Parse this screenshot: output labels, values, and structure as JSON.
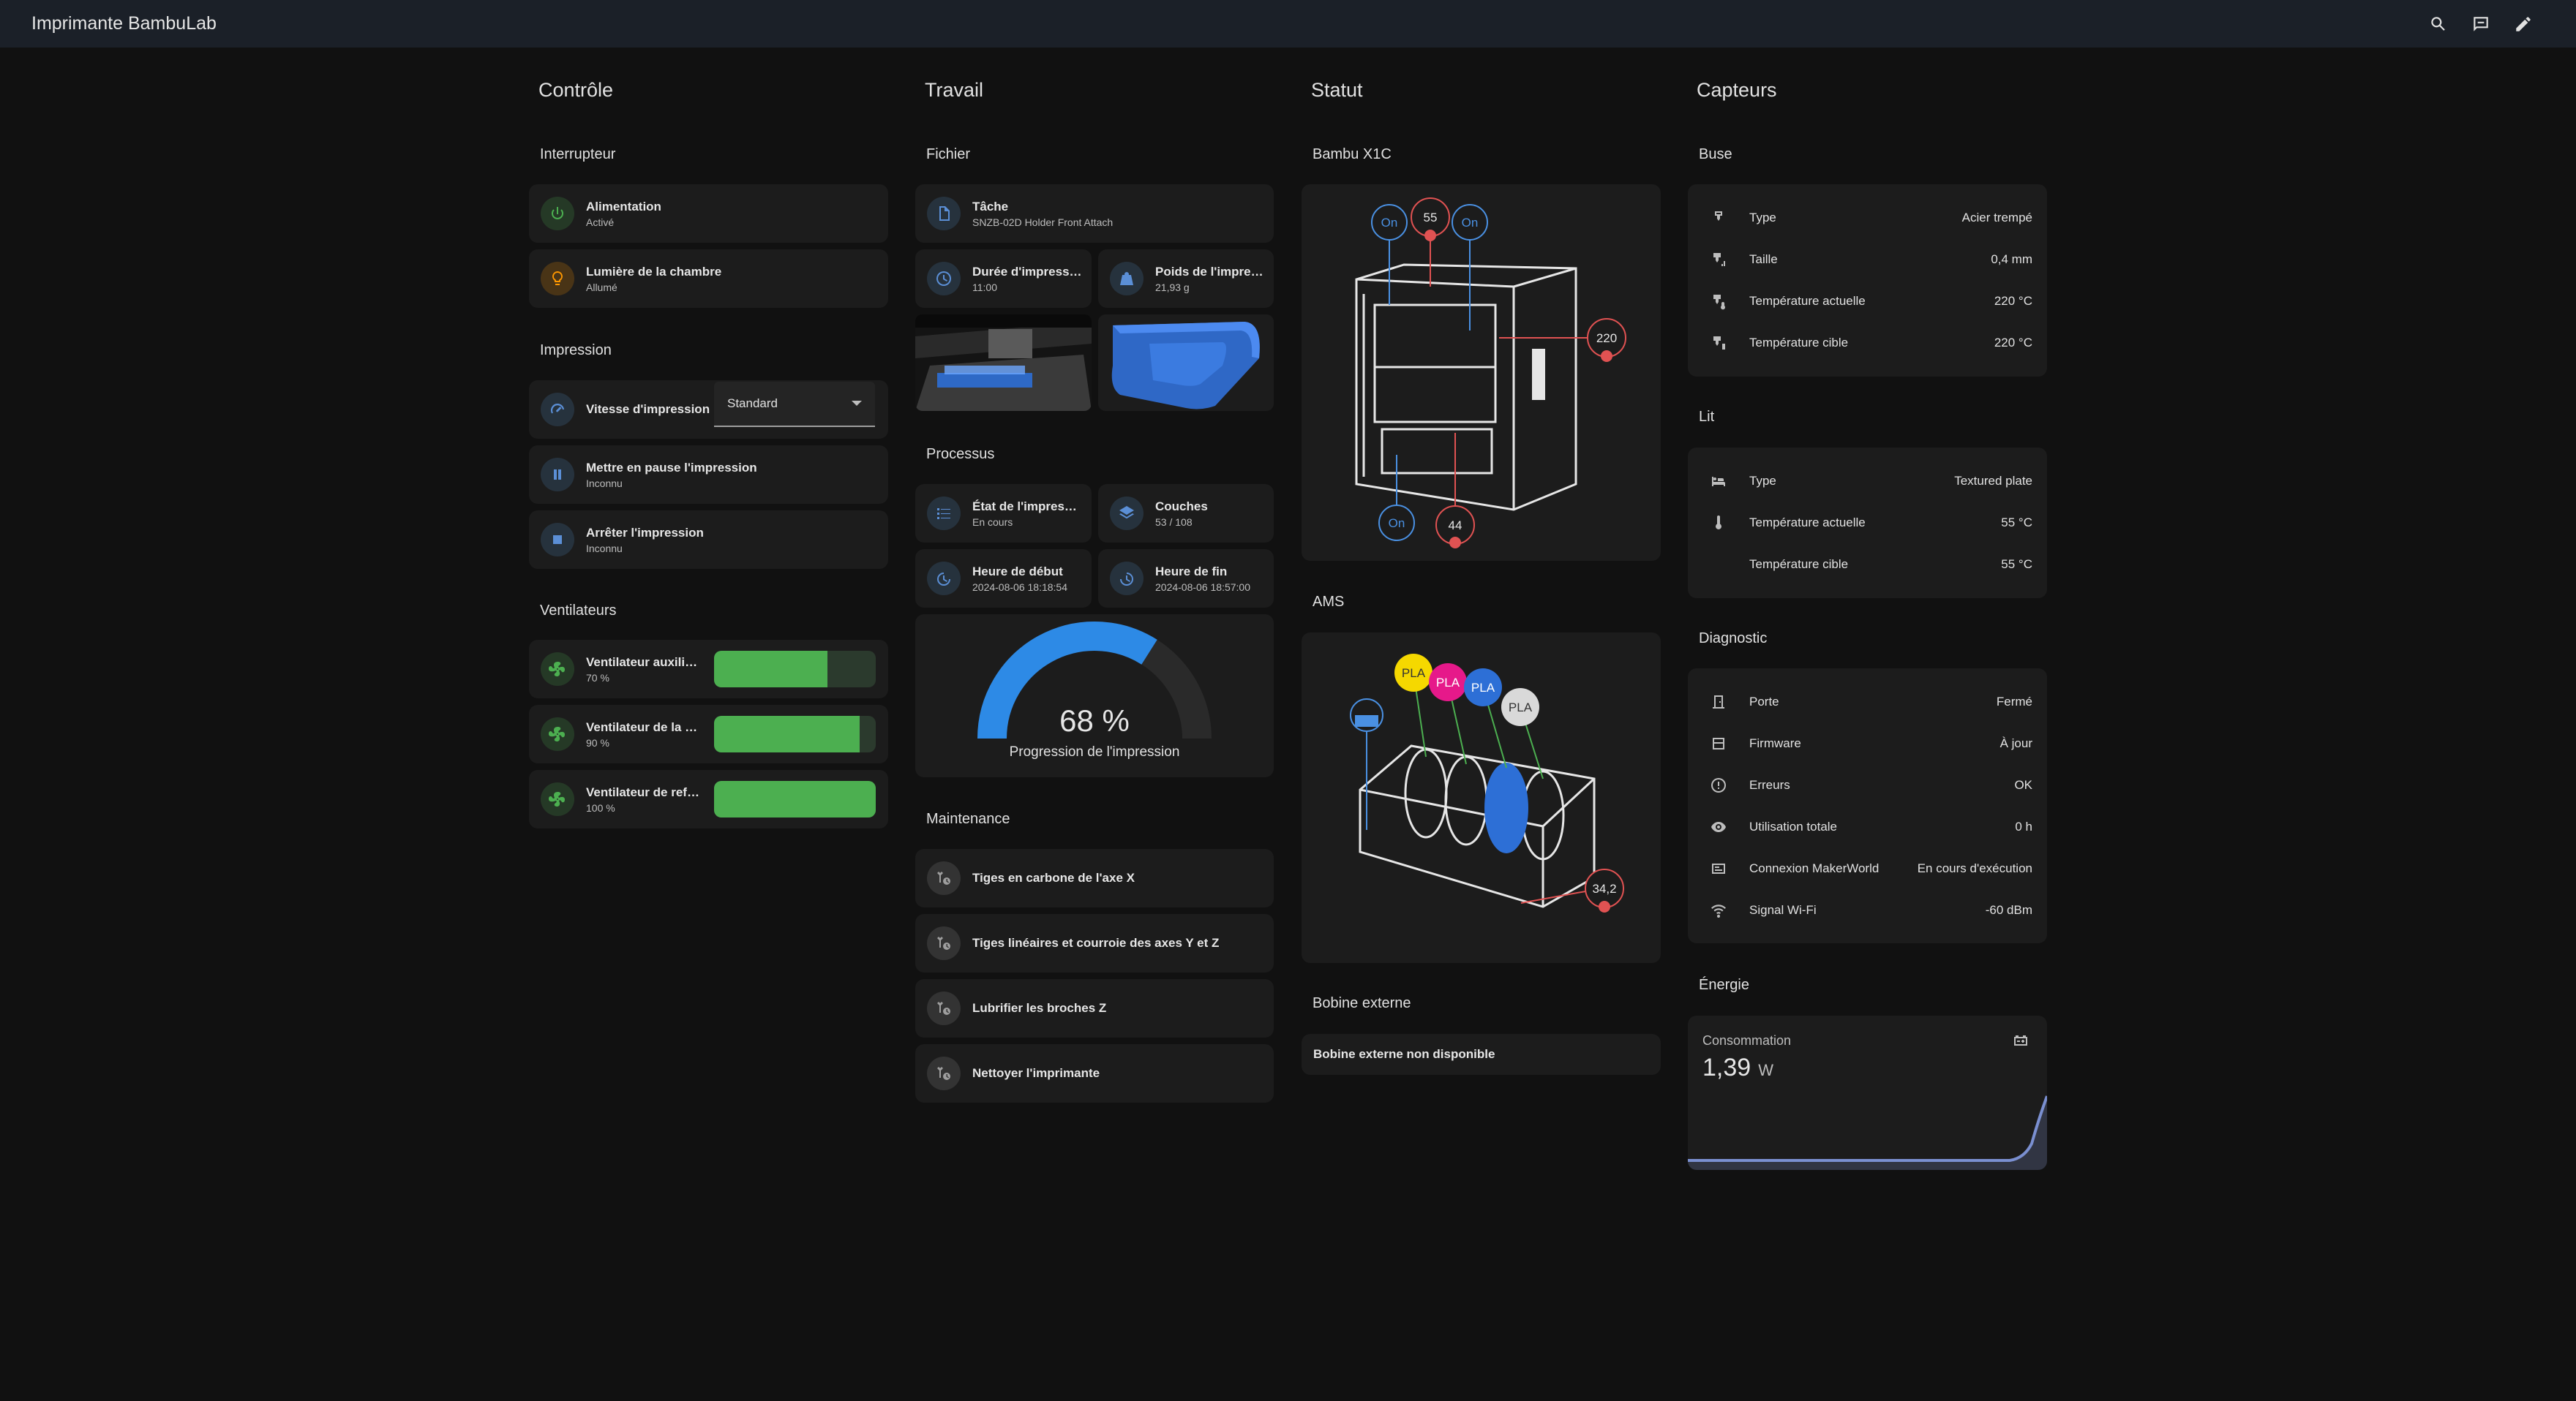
{
  "app": {
    "title": "Imprimante BambuLab"
  },
  "columns": {
    "control": "Contrôle",
    "job": "Travail",
    "status": "Statut",
    "sensors": "Capteurs"
  },
  "control": {
    "switch_title": "Interrupteur",
    "power": {
      "name": "Alimentation",
      "state": "Activé"
    },
    "light": {
      "name": "Lumière de la chambre",
      "state": "Allumé"
    },
    "print_title": "Impression",
    "speed": {
      "name": "Vitesse d'impression",
      "value": "Standard"
    },
    "pause": {
      "name": "Mettre en pause l'impression",
      "state": "Inconnu"
    },
    "stop": {
      "name": "Arrêter l'impression",
      "state": "Inconnu"
    },
    "fans_title": "Ventilateurs",
    "fans": [
      {
        "name": "Ventilateur auxiliaire",
        "state": "70 %",
        "level": 0.7
      },
      {
        "name": "Ventilateur de la ch...",
        "state": "90 %",
        "level": 0.9
      },
      {
        "name": "Ventilateur de refro...",
        "state": "100 %",
        "level": 1.0
      }
    ]
  },
  "job": {
    "file_title": "Fichier",
    "task": {
      "name": "Tâche",
      "state": "SNZB-02D Holder Front Attach"
    },
    "duration": {
      "name": "Durée d'impression",
      "state": "11:00"
    },
    "weight": {
      "name": "Poids de l'impres...",
      "state": "21,93 g"
    },
    "process_title": "Processus",
    "print_state": {
      "name": "État de l'impressi...",
      "state": "En cours"
    },
    "layers": {
      "name": "Couches",
      "state": "53 / 108"
    },
    "start": {
      "name": "Heure de début",
      "state": "2024-08-06 18:18:54"
    },
    "end": {
      "name": "Heure de fin",
      "state": "2024-08-06 18:57:00"
    },
    "progress": {
      "value": "68 %",
      "label": "Progression de l'impression",
      "fraction": 0.68
    },
    "maintenance_title": "Maintenance",
    "maintenance": [
      "Tiges en carbone de l'axe X",
      "Tiges linéaires et courroie des axes Y et Z",
      "Lubrifier les broches Z",
      "Nettoyer l'imprimante"
    ]
  },
  "status": {
    "printer_title": "Bambu X1C",
    "printer_badges": {
      "fan1": "On",
      "temp_chamber": "55",
      "fan2": "On",
      "nozzle": "220",
      "fan3": "On",
      "bed": "44"
    },
    "ams_title": "AMS",
    "ams_spools": [
      {
        "label": "PLA",
        "color": "#f5d800"
      },
      {
        "label": "PLA",
        "color": "#e6198a"
      },
      {
        "label": "PLA",
        "color": "#2d6fd6"
      },
      {
        "label": "PLA",
        "color": "#d9d9d9"
      }
    ],
    "ams_temp": "34,2",
    "external_title": "Bobine externe",
    "external_text": "Bobine externe non disponible"
  },
  "sensors": {
    "nozzle_title": "Buse",
    "nozzle": [
      {
        "label": "Type",
        "value": "Acier trempé"
      },
      {
        "label": "Taille",
        "value": "0,4 mm"
      },
      {
        "label": "Température actuelle",
        "value": "220 °C"
      },
      {
        "label": "Température cible",
        "value": "220 °C"
      }
    ],
    "bed_title": "Lit",
    "bed": [
      {
        "label": "Type",
        "value": "Textured plate"
      },
      {
        "label": "Température actuelle",
        "value": "55 °C"
      },
      {
        "label": "Température cible",
        "value": "55 °C"
      }
    ],
    "diag_title": "Diagnostic",
    "diag": [
      {
        "label": "Porte",
        "value": "Fermé"
      },
      {
        "label": "Firmware",
        "value": "À jour"
      },
      {
        "label": "Erreurs",
        "value": "OK"
      },
      {
        "label": "Utilisation totale",
        "value": "0 h"
      },
      {
        "label": "Connexion MakerWorld",
        "value": "En cours d'exécution"
      },
      {
        "label": "Signal Wi-Fi",
        "value": "-60 dBm"
      }
    ],
    "energy_title": "Énergie",
    "consumption": {
      "label": "Consommation",
      "value": "1,39",
      "unit": "W"
    }
  },
  "colors": {
    "accent": "#4a90e2",
    "green": "#4caf50",
    "orange": "#ff9800",
    "badge_red": "#e05252"
  }
}
